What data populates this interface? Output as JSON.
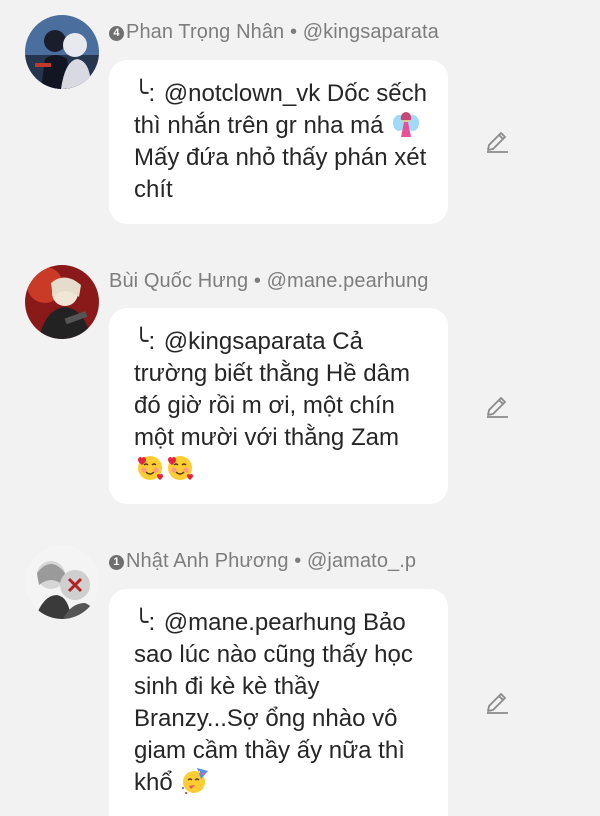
{
  "comments": [
    {
      "badge": "4",
      "name": "Phan Trọng Nhân",
      "separator": "•",
      "handle": "@kingsaparata",
      "reply_arrow": "╰:",
      "text_before": "@notclown_vk Dốc sếch thì nhắn trên gr nha má",
      "emoji_1": "fairy-emoji",
      "text_after": "Mấy đứa nhỏ thấy phán xét chít",
      "edit_icon": "pencil-icon"
    },
    {
      "badge": "",
      "name": "Bùi Quốc Hưng",
      "separator": "•",
      "handle": "@mane.pearhung",
      "reply_arrow": "╰:",
      "text_before": "@kingsaparata Cả trường biết thằng Hề dâm đó giờ rồi m ơi, một chín một mười với thằng Zam",
      "emoji_1": "smiling-face-with-hearts-emoji",
      "emoji_2": "smiling-face-with-hearts-emoji",
      "edit_icon": "pencil-icon"
    },
    {
      "badge": "1",
      "name": "Nhật Anh Phương",
      "separator": "•",
      "handle": "@jamato_.p",
      "reply_arrow": "╰:",
      "text_before": "@mane.pearhung Bảo sao lúc nào cũng thấy học sinh đi kè kè thầy Branzy...Sợ ổng nhào vô giam cầm thầy ấy nữa thì khổ",
      "emoji_1": "partying-face-emoji",
      "edit_icon": "pencil-icon"
    }
  ],
  "colors": {
    "background": "#f2f2f2",
    "bubble": "#ffffff",
    "meta_text": "#7d7d7d",
    "body_text": "#262626"
  }
}
